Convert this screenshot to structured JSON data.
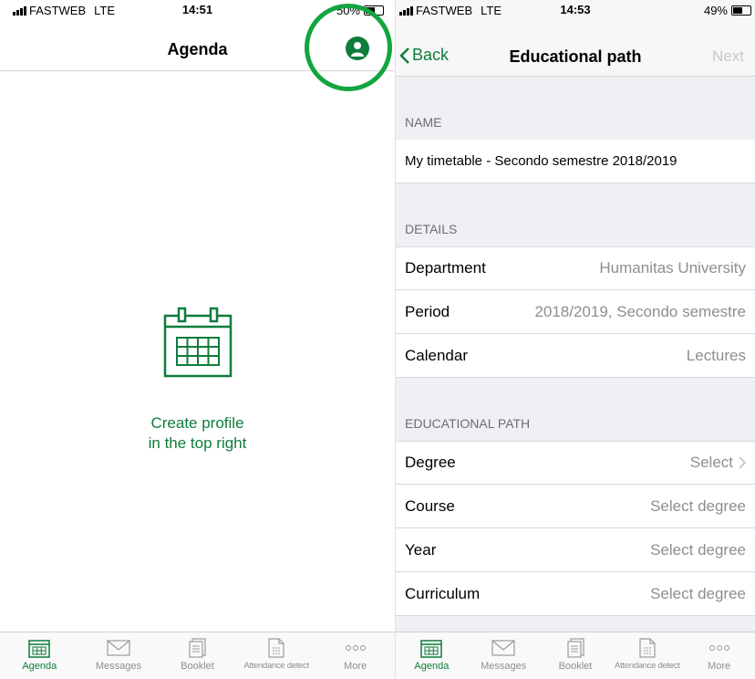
{
  "left": {
    "status": {
      "carrier": "FASTWEB",
      "network": "LTE",
      "time": "14:51",
      "battery": "50%"
    },
    "nav": {
      "title": "Agenda"
    },
    "empty": {
      "line1": "Create profile",
      "line2": "in the top right"
    }
  },
  "right": {
    "status": {
      "carrier": "FASTWEB",
      "network": "LTE",
      "time": "14:53",
      "battery": "49%"
    },
    "nav": {
      "back": "Back",
      "title": "Educational path",
      "next": "Next"
    },
    "sections": {
      "name": "NAME",
      "details": "DETAILS",
      "edu": "EDUCATIONAL PATH"
    },
    "name_value": "My timetable - Secondo semestre 2018/2019",
    "details": [
      {
        "label": "Department",
        "value": "Humanitas University"
      },
      {
        "label": "Period",
        "value": "2018/2019, Secondo semestre"
      },
      {
        "label": "Calendar",
        "value": "Lectures"
      }
    ],
    "edu": [
      {
        "label": "Degree",
        "value": "Select"
      },
      {
        "label": "Course",
        "value": "Select degree"
      },
      {
        "label": "Year",
        "value": "Select degree"
      },
      {
        "label": "Curriculum",
        "value": "Select degree"
      }
    ]
  },
  "tabs": [
    "Agenda",
    "Messages",
    "Booklet",
    "Attendance detect",
    "More"
  ],
  "colors": {
    "accent": "#0e7c3b",
    "highlight": "#13a53f"
  }
}
